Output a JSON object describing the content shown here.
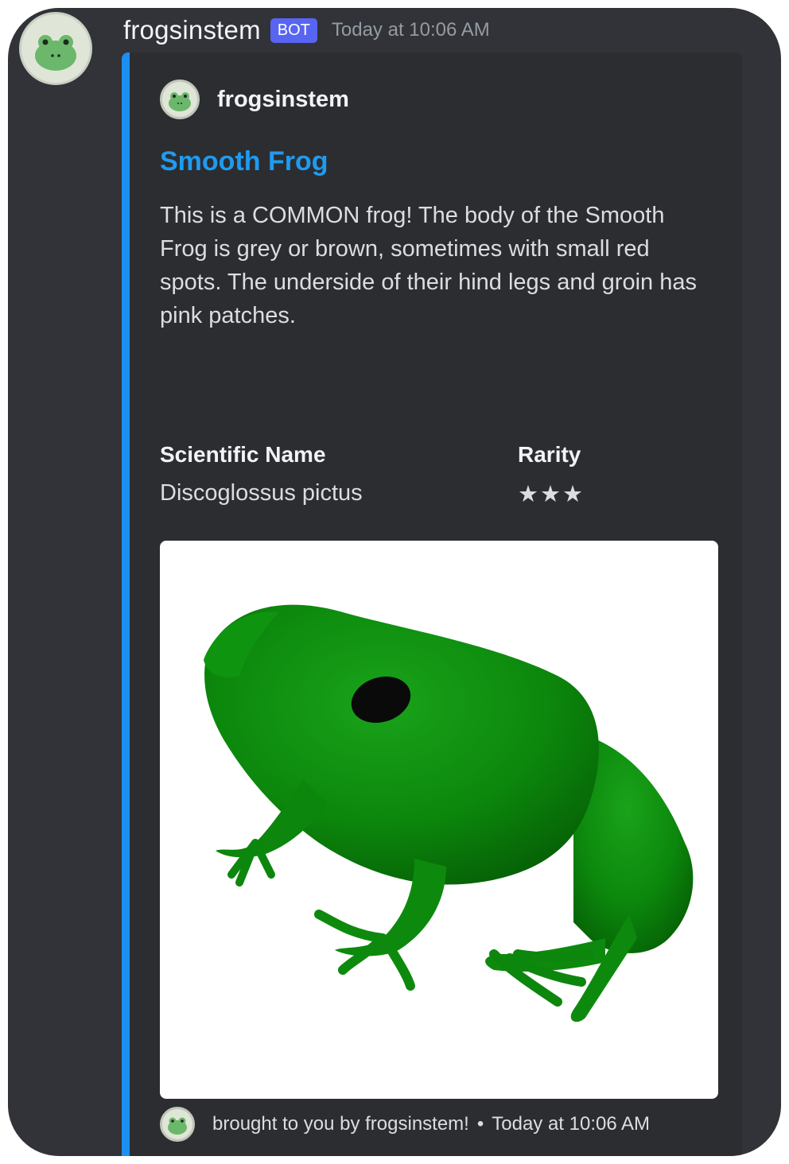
{
  "message": {
    "username": "frogsinstem",
    "badge": "BOT",
    "timestamp": "Today at 10:06 AM",
    "avatar_icon": "frog-face-icon"
  },
  "embed": {
    "accent_color": "#1e8ff0",
    "author": {
      "name": "frogsinstem",
      "icon": "frog-face-icon"
    },
    "title": "Smooth Frog",
    "description": "This is a COMMON frog! The body of the Smooth Frog is grey or brown, sometimes with small red spots. The underside of their hind legs and groin has pink patches.",
    "fields": [
      {
        "name": "Scientific Name",
        "value": "Discoglossus pictus"
      },
      {
        "name": "Rarity",
        "value": "★★★"
      }
    ],
    "image": {
      "subject": "green 3D frog render",
      "color": "#0f8f0f"
    },
    "footer": {
      "text": "brought to you by frogsinstem!",
      "separator": "•",
      "timestamp": "Today at 10:06 AM"
    }
  }
}
